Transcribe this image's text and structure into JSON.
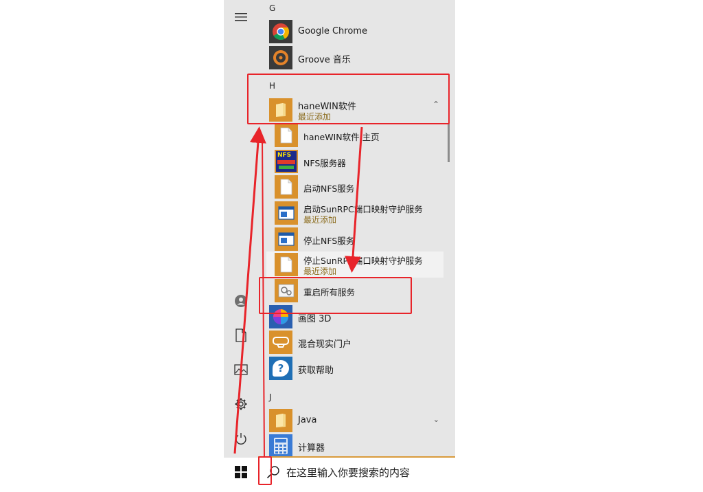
{
  "sections": {
    "g": "G",
    "h": "H",
    "j": "J"
  },
  "apps": {
    "chrome": "Google Chrome",
    "groove": "Groove 音乐",
    "hanewin": {
      "name": "haneWIN软件",
      "sub": "最近添加"
    },
    "paint3d": "画图 3D",
    "mixed_reality": "混合现实门户",
    "get_help": "获取帮助",
    "java": "Java",
    "calculator": "计算器"
  },
  "hanewin_items": [
    {
      "name": "haneWIN软件 主页",
      "sub": ""
    },
    {
      "name": "NFS服务器",
      "sub": ""
    },
    {
      "name": "启动NFS服务",
      "sub": ""
    },
    {
      "name": "启动SunRPC端口映射守护服务",
      "sub": "最近添加"
    },
    {
      "name": "停止NFS服务",
      "sub": ""
    },
    {
      "name": "停止SunRPC端口映射守护服务",
      "sub": "最近添加"
    },
    {
      "name": "重启所有服务",
      "sub": ""
    }
  ],
  "icons": {
    "nfs_tile_text": "NFS",
    "paint3d_tile_text": "3D",
    "get_help_tile_text": "?"
  },
  "search": {
    "placeholder": "在这里输入你要搜索的内容"
  },
  "colors": {
    "menu_bg": "#e6e6e6",
    "tile_orange": "#d9912c",
    "recent_text": "#8a6a1a",
    "annotation_red": "#e8242a",
    "hover_row": "#f2f2f2"
  }
}
